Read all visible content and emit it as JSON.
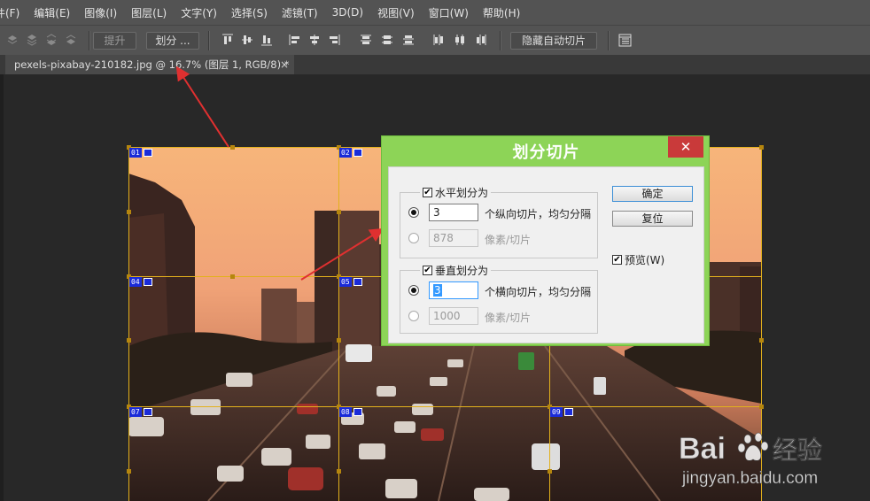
{
  "menu": [
    "件(F)",
    "编辑(E)",
    "图像(I)",
    "图层(L)",
    "文字(Y)",
    "选择(S)",
    "滤镜(T)",
    "3D(D)",
    "视图(V)",
    "窗口(W)",
    "帮助(H)"
  ],
  "options_bar": {
    "promote_label": "提升",
    "divide_label": "划分 ...",
    "hide_auto_label": "隐藏自动切片"
  },
  "document_tab": {
    "title": "pexels-pixabay-210182.jpg @ 16.7% (图层 1, RGB/8) *",
    "close": "×"
  },
  "slices": [
    "01",
    "02",
    "04",
    "05",
    "07",
    "08",
    "09"
  ],
  "dialog": {
    "title": "划分切片",
    "close": "✕",
    "horizontal": {
      "label": "水平划分为",
      "checked": true,
      "count_value": "3",
      "count_label": "个纵向切片，均匀分隔",
      "pixels_value": "878",
      "pixels_label": "像素/切片"
    },
    "vertical": {
      "label": "垂直划分为",
      "checked": true,
      "count_value": "3",
      "count_label": "个横向切片，均匀分隔",
      "pixels_value": "1000",
      "pixels_label": "像素/切片"
    },
    "ok_label": "确定",
    "reset_label": "复位",
    "preview_label": "预览(W)",
    "preview_checked": true
  },
  "watermark": {
    "brand_left": "Bai",
    "brand_right": "经验",
    "url": "jingyan.baidu.com"
  },
  "colors": {
    "dialog_title_bg": "#8dd457",
    "close_bg": "#c93a3a",
    "slice_line": "#e3b11c",
    "slice_badge": "#1a2bd9",
    "arrow": "#e03030"
  }
}
